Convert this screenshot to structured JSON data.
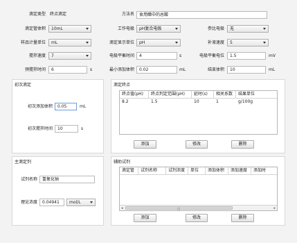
{
  "top": {
    "titration_type_label": "滴定类型",
    "titration_type_value": "终点滴定",
    "method_name_label": "方法名",
    "method_name_value": "食用醋中的总酸",
    "burette_volume_label": "滴定管体积",
    "burette_volume_value": "10mL",
    "working_electrode_label": "工作电极",
    "working_electrode_value": "pH复合电极",
    "reference_electrode_label": "参比电极",
    "reference_electrode_value": "无",
    "sample_unit_label": "样品计量单位",
    "sample_unit_value": "mL",
    "display_unit_label": "滴定显示单位",
    "display_unit_value": "pH",
    "refill_speed_label": "补液速度",
    "refill_speed_value": "5",
    "stir_speed_label": "搅拌速度",
    "stir_speed_value": "7",
    "potential_balance_time_label": "电极平衡时间",
    "potential_balance_time_value": "4",
    "potential_balance_time_unit": "s",
    "potential_balance_value_label": "电极平衡电位",
    "potential_balance_value_value": "1.5",
    "potential_balance_value_unit": "mV",
    "pre_stir_time_label": "预搅拌时间",
    "pre_stir_time_value": "6",
    "pre_stir_time_unit": "s",
    "min_add_volume_label": "最小添加体积",
    "min_add_volume_value": "0.02",
    "min_add_volume_unit": "mL",
    "end_volume_label": "结束体积",
    "end_volume_value": "10",
    "end_volume_unit": "mL"
  },
  "initial_titration": {
    "title": "初次滴定",
    "add_volume_label": "初次添加体积",
    "add_volume_value": "0.05",
    "add_volume_unit": "mL",
    "stir_time_label": "初次搅拌时间",
    "stir_time_value": "10",
    "stir_time_unit": "s"
  },
  "endpoint": {
    "title": "滴定终点",
    "columns": [
      "终点值(pH)",
      "终点判定范围(pH)",
      "延时(s)",
      "相关系数",
      "结果单位"
    ],
    "rows": [
      [
        "8.2",
        "1.5",
        "10",
        "1",
        "g/100g"
      ]
    ],
    "add_label": "添加",
    "edit_label": "修改",
    "delete_label": "删除"
  },
  "main_reagent": {
    "title": "主滴定剂",
    "name_label": "试剂名称",
    "name_value": "氢氧化钠",
    "concentration_label": "理论浓度",
    "concentration_value": "0.04941",
    "concentration_unit": "mol/L"
  },
  "aux_reagent": {
    "title": "辅助试剂",
    "columns": [
      "滴定管",
      "试剂名称",
      "试剂浓度",
      "单位",
      "添加体积",
      "添加速度",
      "添加时"
    ],
    "scroll_left": "◂",
    "scroll_right": "▸",
    "scroll_grip": "|||",
    "add_label": "添加",
    "edit_label": "修改",
    "delete_label": "删除"
  }
}
